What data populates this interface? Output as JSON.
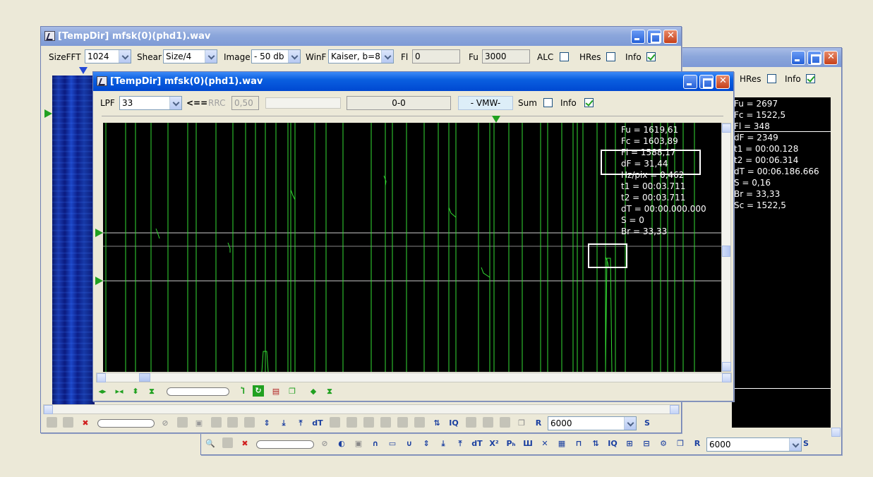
{
  "back_window": {
    "title": "",
    "hres_label": "HRes",
    "info_label": "Info",
    "hres_checked": false,
    "info_checked": true,
    "info_lines_top": [
      "Fu = 2697",
      "Fc = 1522,5",
      "Fl = 348"
    ],
    "info_lines": [
      "dF = 2349",
      "t1 = 00:00.128",
      "t2 = 00:06.314",
      "dT = 00:06.186.666",
      "S = 0,16",
      "Br = 33,33",
      "Sc = 1522,5"
    ],
    "bottom_combo_value": "6000",
    "toolbar_letter_r": "R",
    "toolbar_letter_s": "S"
  },
  "main_window": {
    "title": "[TempDir] mfsk(0)(phd1).wav",
    "sizefft_label": "SizeFFT",
    "sizefft_value": "1024",
    "shear_label": "Shear",
    "shear_value": "Size/4",
    "image_label": "Image",
    "image_value": "- 50 db",
    "winf_label": "WinF",
    "winf_value": "Kaiser, b=8",
    "fl_label": "Fl",
    "fl_value": "0",
    "fu_label": "Fu",
    "fu_value": "3000",
    "alc_label": "ALC",
    "alc_checked": false,
    "hres_label": "HRes",
    "hres_checked": false,
    "info_label": "Info",
    "info_checked": true,
    "bottom_combo_value": "6000",
    "toolbar_letter_r": "R",
    "toolbar_letter_s": "S"
  },
  "front_window": {
    "title": "[TempDir] mfsk(0)(phd1).wav",
    "lpf_label": "LPF",
    "lpf_value": "33",
    "arrow_label": "<==",
    "rrc_label": "RRC",
    "rrc_value": "0,50",
    "range_value": "0-0",
    "vmw_label": "- VMW-",
    "sum_label": "Sum",
    "sum_checked": false,
    "info_label": "Info",
    "info_checked": true,
    "info_lines": [
      "Fu = 1619,61",
      "Fc = 1603,89",
      "Fl = 1588,17",
      "dF = 31,44",
      "Hz/pix = 0,462",
      "t1 = 00:03.711",
      "t2 = 00:03.711",
      "dT = 00:00.000.000",
      "S = 0",
      "Br = 33,33"
    ]
  },
  "colors": {
    "trace": "#33dd33",
    "marker": "#21a121",
    "titlebar_active": "#0a5fe0",
    "titlebar_inactive": "#8ba6db"
  }
}
